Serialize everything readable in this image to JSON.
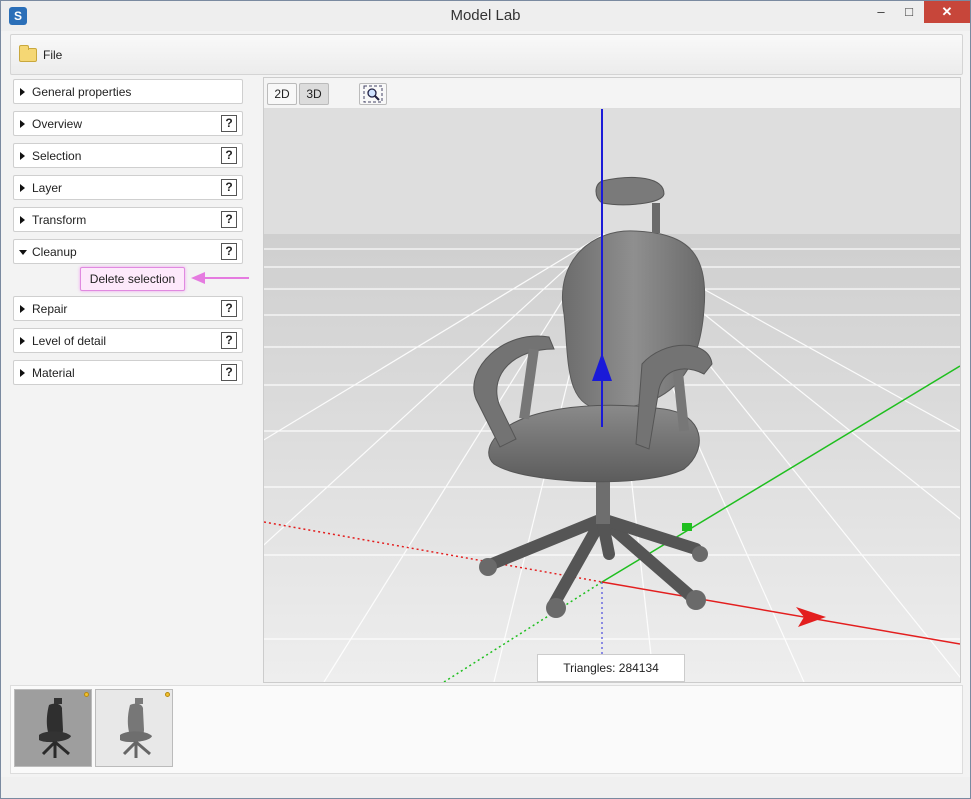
{
  "window": {
    "title": "Model Lab",
    "minimize": "–",
    "maximize": "□",
    "close": "✕"
  },
  "toolbar": {
    "file_label": "File"
  },
  "sections": [
    {
      "label": "General properties",
      "help": ""
    },
    {
      "label": "Overview",
      "help": "?"
    },
    {
      "label": "Selection",
      "help": "?"
    },
    {
      "label": "Layer",
      "help": "?"
    },
    {
      "label": "Transform",
      "help": "?"
    },
    {
      "label": "Cleanup",
      "help": "?"
    },
    {
      "label": "Repair",
      "help": "?"
    },
    {
      "label": "Level of detail",
      "help": "?"
    },
    {
      "label": "Material",
      "help": "?"
    }
  ],
  "cleanup": {
    "delete_selection_label": "Delete selection"
  },
  "viewport": {
    "btn_2d": "2D",
    "btn_3d": "3D",
    "active_mode": "3D",
    "triangles_label": "Triangles: 284134"
  },
  "colors": {
    "x_axis": "#e31e1e",
    "y_axis": "#1fbf1f",
    "z_axis": "#1a1ad8",
    "highlight_arrow": "#e57be0",
    "close_button": "#c7463a"
  },
  "icons": {
    "app": "app-logo-icon",
    "file": "folder-icon",
    "zoom": "zoom-fit-icon"
  },
  "thumbnails": [
    {
      "name": "chair-model-1"
    },
    {
      "name": "chair-model-2"
    }
  ]
}
